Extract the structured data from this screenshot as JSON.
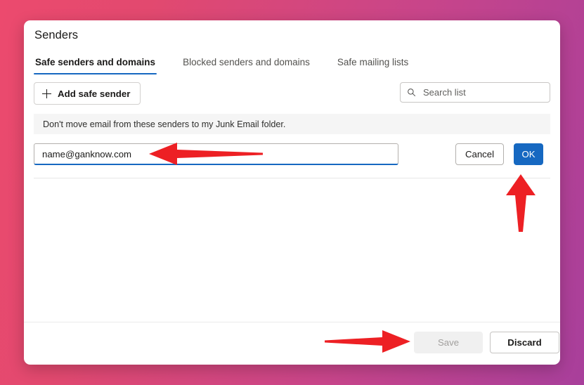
{
  "background": {
    "gradient_start": "#ec4a6e",
    "gradient_end": "#a83f9b"
  },
  "dialog": {
    "title": "Senders",
    "accent_color": "#1668c1",
    "tabs": [
      {
        "label": "Safe senders and domains",
        "active": true
      },
      {
        "label": "Blocked senders and domains",
        "active": false
      },
      {
        "label": "Safe mailing lists",
        "active": false
      }
    ],
    "toolbar": {
      "add_label": "Add safe sender",
      "add_icon": "plus-icon",
      "search_placeholder": "Search list",
      "search_value": "",
      "search_icon": "search-icon"
    },
    "info_bar": {
      "text": "Don't move email from these senders to my Junk Email folder."
    },
    "edit_row": {
      "input_value": "name@ganknow.com",
      "input_placeholder": "",
      "cancel_label": "Cancel",
      "ok_label": "OK",
      "ok_background": "#1668c1"
    },
    "footer": {
      "save_label": "Save",
      "save_disabled": true,
      "discard_label": "Discard"
    }
  },
  "annotations": {
    "color": "#ed2024",
    "arrows": [
      {
        "name": "arrow-pointing-to-sender-input",
        "direction": "left"
      },
      {
        "name": "arrow-pointing-to-ok-button",
        "direction": "up"
      },
      {
        "name": "arrow-pointing-to-save-button",
        "direction": "right"
      }
    ]
  }
}
